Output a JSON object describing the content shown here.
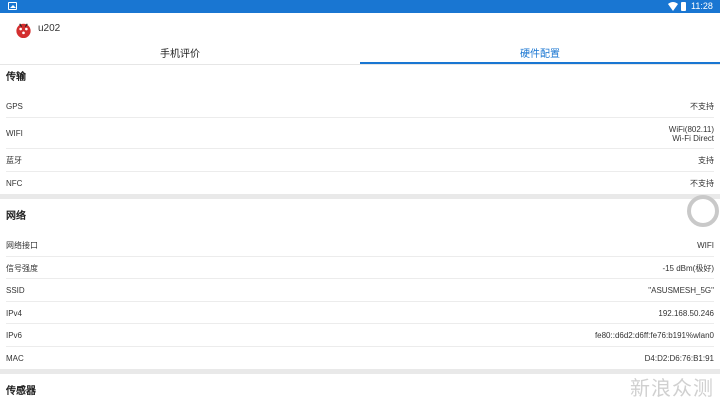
{
  "status_bar": {
    "time": "11:28",
    "left_icon": "image-icon",
    "wifi_icon": "wifi-icon",
    "battery_icon": "battery-icon"
  },
  "app": {
    "title": "u202",
    "logo_icon": "antutu-logo-icon"
  },
  "tabs": [
    {
      "label": "手机评价",
      "active": false
    },
    {
      "label": "硬件配置",
      "active": true
    }
  ],
  "sections": {
    "transport": {
      "title": "传输",
      "rows": [
        {
          "label": "GPS",
          "value": "不支持"
        },
        {
          "label": "WIFI",
          "value": "WiFi(802.11)",
          "value2": "Wi-Fi Direct"
        },
        {
          "label": "蓝牙",
          "value": "支持"
        },
        {
          "label": "NFC",
          "value": "不支持"
        }
      ]
    },
    "network": {
      "title": "网络",
      "rows": [
        {
          "label": "网络接口",
          "value": "WIFI"
        },
        {
          "label": "信号强度",
          "value": "-15 dBm(极好)"
        },
        {
          "label": "SSID",
          "value": "\"ASUSMESH_5G\""
        },
        {
          "label": "IPv4",
          "value": "192.168.50.246"
        },
        {
          "label": "IPv6",
          "value": "fe80::d6d2:d6ff:fe76:b191%wlan0"
        },
        {
          "label": "MAC",
          "value": "D4:D2:D6:76:B1:91"
        }
      ]
    },
    "sensors": {
      "title": "传感器"
    }
  },
  "watermark": "新浪众测",
  "colors": {
    "accent": "#1976d2",
    "section_gap": "#e9e9e9"
  }
}
